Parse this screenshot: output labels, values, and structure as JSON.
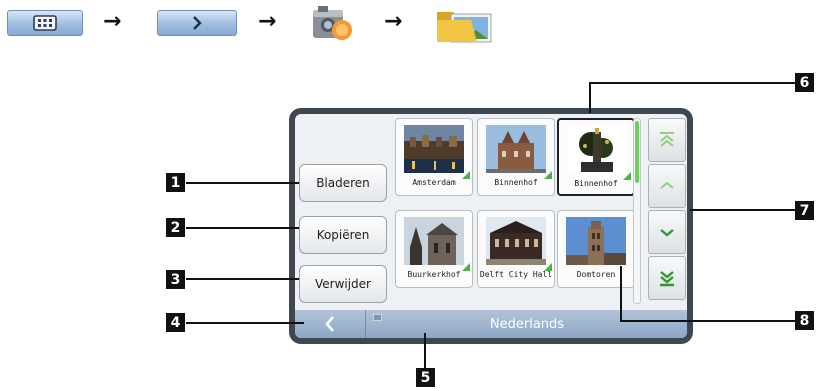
{
  "nav_path": {
    "steps": [
      "menu-grid-icon",
      "next-arrow-icon",
      "camera-icon",
      "photo-folder-icon"
    ],
    "separator": "→"
  },
  "sidebar": {
    "browse_label": "Bladeren",
    "copy_label": "Kopiëren",
    "delete_label": "Verwijder"
  },
  "gallery": {
    "photos": [
      {
        "caption": "Amsterdam",
        "selected": false
      },
      {
        "caption": "Binnenhof",
        "selected": false
      },
      {
        "caption": "Binnenhof",
        "selected": true
      },
      {
        "caption": "Buurkerkhof",
        "selected": false
      },
      {
        "caption": "Delft City Hall",
        "selected": false
      },
      {
        "caption": "Domtoren",
        "selected": false
      }
    ]
  },
  "scroll": {
    "position_fraction": 0.0
  },
  "bottom_bar": {
    "back_icon": "chevron-left-icon",
    "location": "Nederlands"
  },
  "callouts": [
    "1",
    "2",
    "3",
    "4",
    "5",
    "6",
    "7",
    "8"
  ],
  "colors": {
    "accent_green": "#49b24a",
    "bar_blue": "#9fb4d1",
    "frame": "#3d4852"
  }
}
